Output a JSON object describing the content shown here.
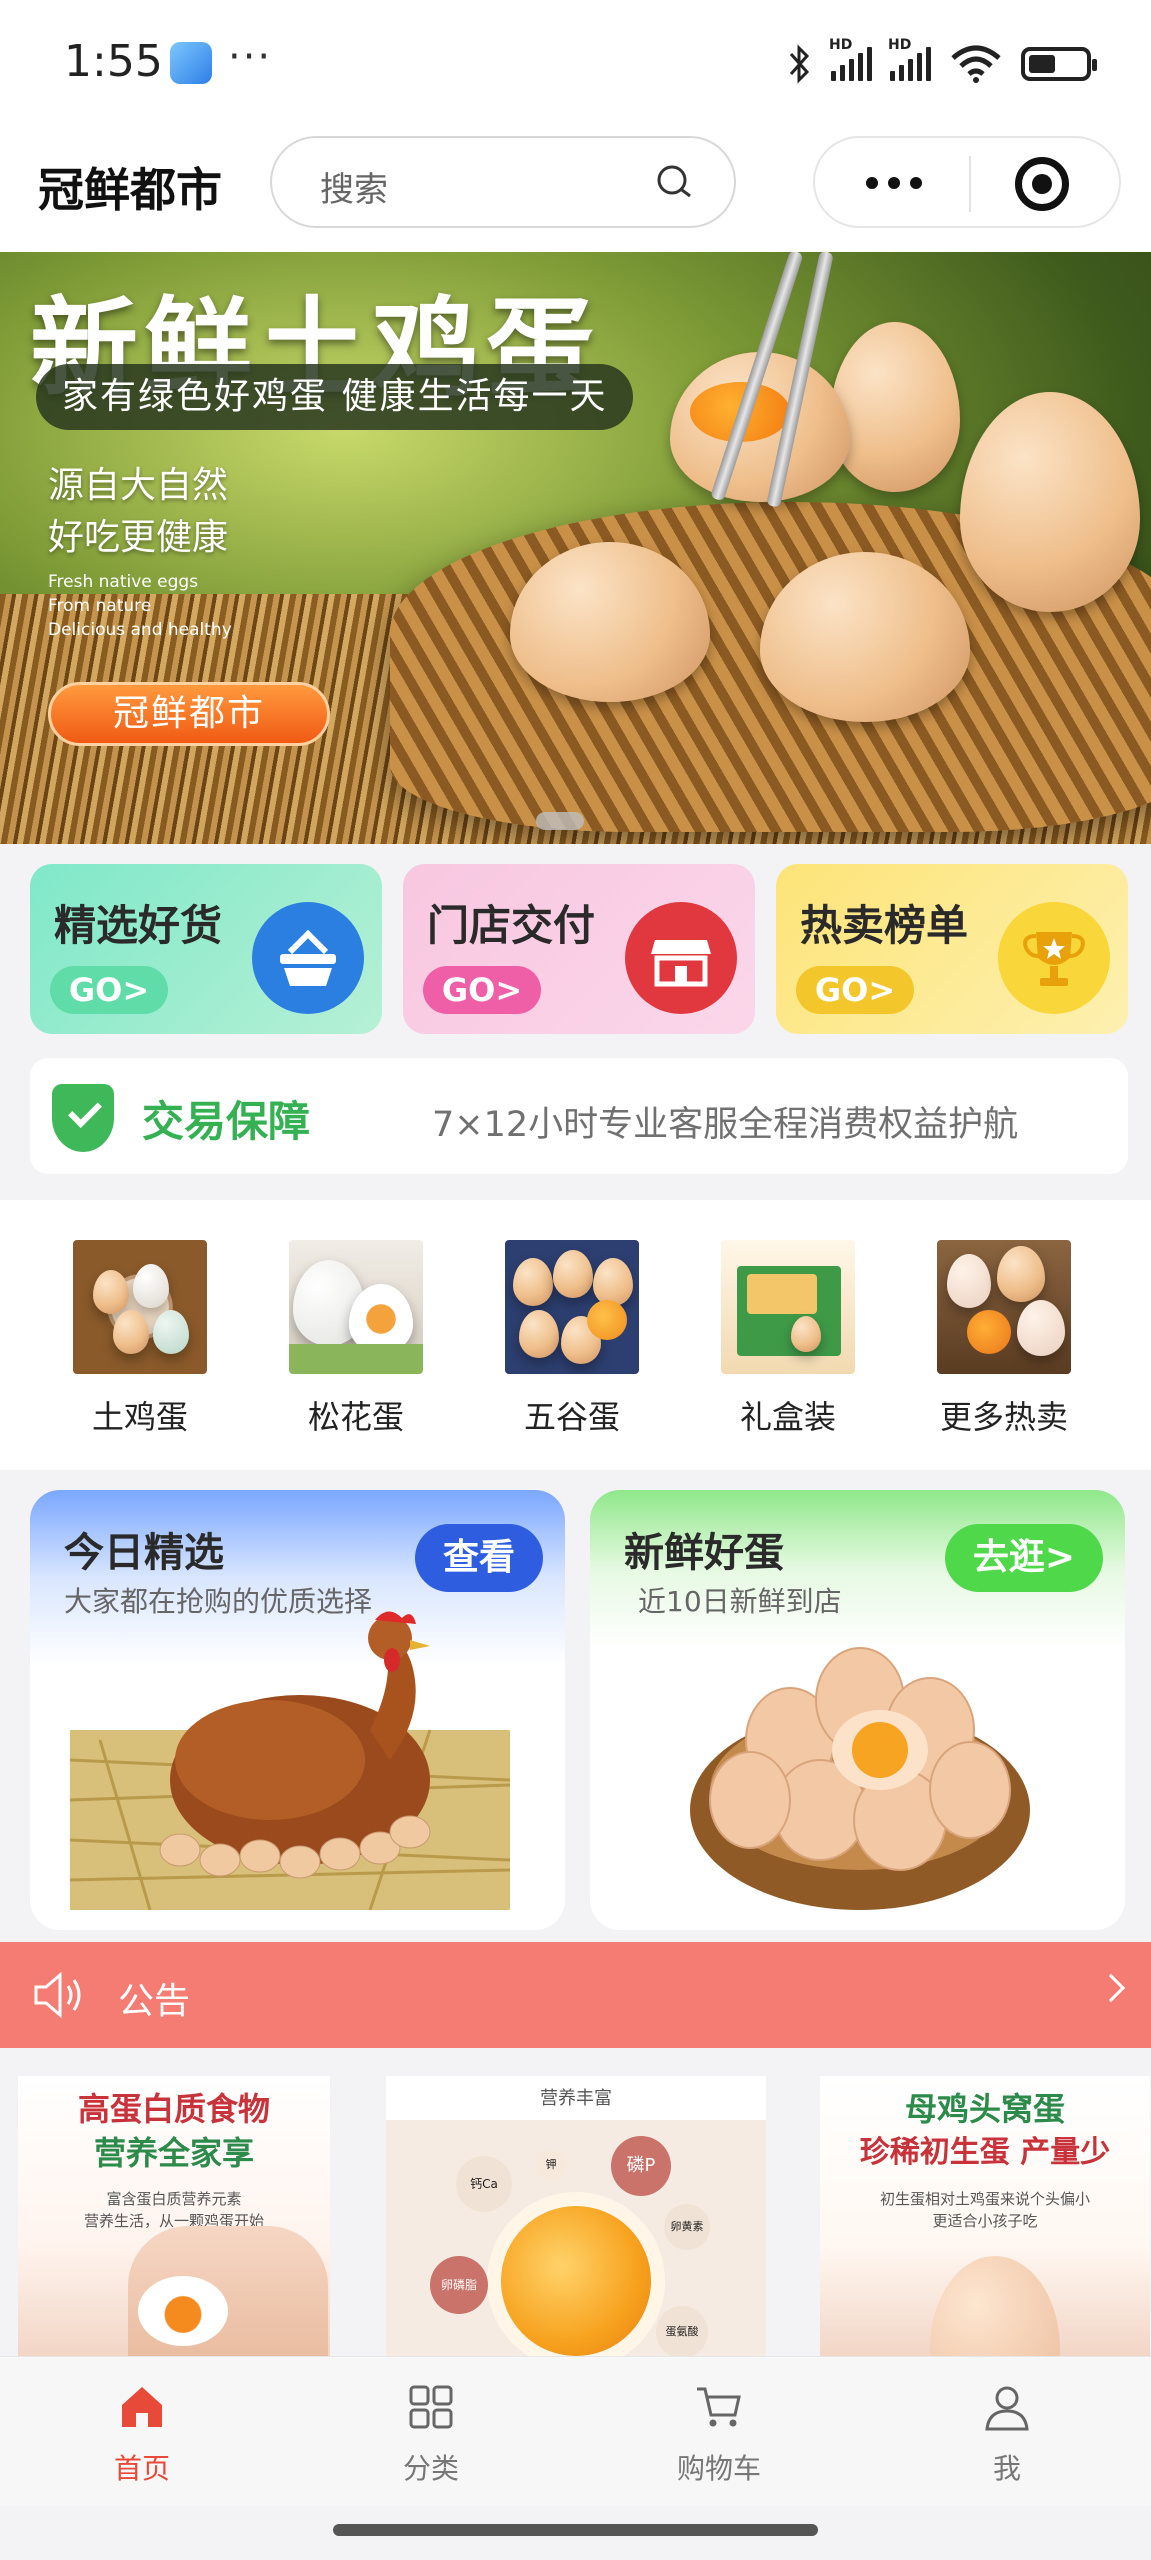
{
  "status_bar": {
    "time": "1:55",
    "dots": "···",
    "hd": "HD"
  },
  "header": {
    "title": "冠鲜都市",
    "search_placeholder": "搜索"
  },
  "banner": {
    "title": "新鲜土鸡蛋",
    "subtitle": "家有绿色好鸡蛋 健康生活每一天",
    "side_line1": "源自大自然",
    "side_line2": "好吃更健康",
    "eng_line1": "Fresh native eggs",
    "eng_line2": "From nature",
    "eng_line3": "Delicious and healthy",
    "button": "冠鲜都市"
  },
  "quick_entries": [
    {
      "title": "精选好货",
      "go": "GO>",
      "icon": "basket-icon"
    },
    {
      "title": "门店交付",
      "go": "GO>",
      "icon": "store-icon"
    },
    {
      "title": "热卖榜单",
      "go": "GO>",
      "icon": "trophy-icon"
    }
  ],
  "guarantee": {
    "title": "交易保障",
    "text": "7×12小时专业客服全程消费权益护航"
  },
  "categories": [
    {
      "label": "土鸡蛋"
    },
    {
      "label": "松花蛋"
    },
    {
      "label": "五谷蛋"
    },
    {
      "label": "礼盒装"
    },
    {
      "label": "更多热卖"
    }
  ],
  "promos": {
    "left": {
      "title": "今日精选",
      "subtitle": "大家都在抢购的优质选择",
      "button": "查看"
    },
    "right": {
      "title": "新鲜好蛋",
      "subtitle": "近10日新鲜到店",
      "button": "去逛>"
    }
  },
  "notice": {
    "label": "公告"
  },
  "features": {
    "f1": {
      "line1": "高蛋白质食物",
      "line2": "营养全家享",
      "small1": "富含蛋白质营养元素",
      "small2": "营养生活，从一颗鸡蛋开始"
    },
    "f2": {
      "head": "营养丰富",
      "n1": "钙Ca",
      "n2": "磷P",
      "n3": "钾",
      "n4": "卵磷脂",
      "n5": "卵黄素",
      "n6": "蛋氨酸"
    },
    "f3": {
      "line1": "母鸡头窝蛋",
      "line2": "珍稀初生蛋 产量少",
      "small1": "初生蛋相对土鸡蛋来说个头偏小",
      "small2": "更适合小孩子吃"
    }
  },
  "tabbar": [
    {
      "label": "首页",
      "icon": "home-icon"
    },
    {
      "label": "分类",
      "icon": "category-icon"
    },
    {
      "label": "购物车",
      "icon": "cart-icon"
    },
    {
      "label": "我",
      "icon": "profile-icon"
    }
  ],
  "colors": {
    "accent": "#e84a3a",
    "notice": "#f57c73",
    "guarantee": "#35b154"
  }
}
